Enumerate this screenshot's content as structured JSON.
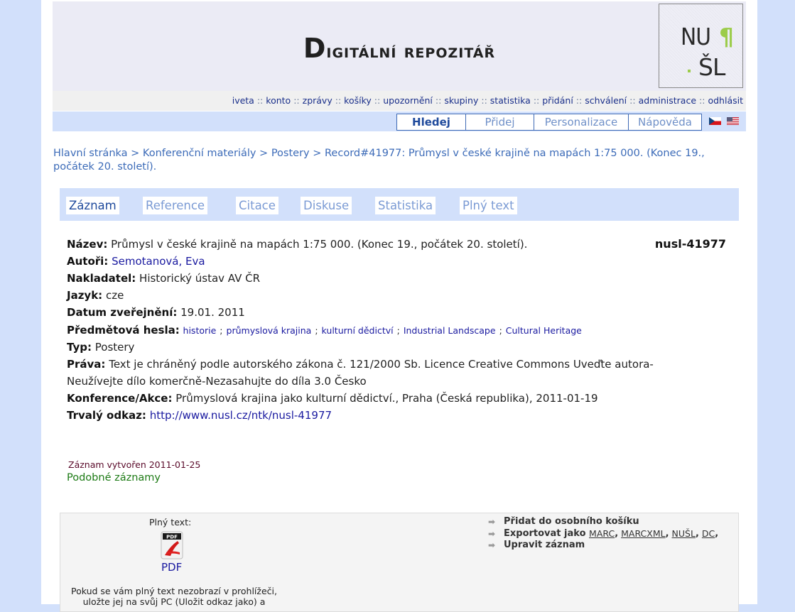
{
  "header": {
    "site_title_first": "D",
    "site_title_rest": "igitální repozitář",
    "logo": {
      "line1": "NU",
      "pilcrow": "¶",
      "line2": "ŠL"
    }
  },
  "userbar": {
    "links": [
      "iveta",
      "konto",
      "zprávy",
      "košíky",
      "upozornění",
      "skupiny",
      "statistika",
      "přidání",
      "schválení",
      "administrace",
      "odhlásit"
    ],
    "separator": "::"
  },
  "nav": {
    "tabs": [
      {
        "label": "Hledej",
        "active": true
      },
      {
        "label": "Přidej",
        "active": false
      },
      {
        "label": "Personalizace",
        "active": false
      },
      {
        "label": "Nápověda",
        "active": false
      }
    ],
    "flags": [
      "czech-flag-icon",
      "us-flag-icon"
    ]
  },
  "breadcrumb": {
    "items": [
      "Hlavní stránka",
      "Konferenční materiály",
      "Postery"
    ],
    "separator": ">",
    "current": "Record#41977: Průmysl v české krajině na mapách 1:75 000. (Konec 19., počátek 20. století)."
  },
  "record_tabs": [
    {
      "label": "Záznam",
      "active": true
    },
    {
      "label": "Reference",
      "active": false
    },
    {
      "label": "Citace",
      "active": false
    },
    {
      "label": "Diskuse",
      "active": false
    },
    {
      "label": "Statistika",
      "active": false
    },
    {
      "label": "Plný text",
      "active": false
    }
  ],
  "record": {
    "id": "nusl-41977",
    "title_label": "Název:",
    "title": "Průmysl v české krajině na mapách 1:75 000. (Konec 19., počátek 20. století).",
    "authors_label": "Autoři:",
    "authors": "Semotanová, Eva",
    "publisher_label": "Nakladatel:",
    "publisher": "Historický ústav AV ČR",
    "language_label": "Jazyk:",
    "language": "cze",
    "date_label": "Datum zveřejnění:",
    "date": "19.01. 2011",
    "keywords_label": "Předmětová hesla:",
    "keywords": [
      "historie",
      "průmyslová krajina",
      "kulturní dědictví",
      "Industrial Landscape",
      "Cultural Heritage"
    ],
    "keyword_separator": ";",
    "type_label": "Typ:",
    "type": "Postery",
    "rights_label": "Práva:",
    "rights_line1": "Text je chráněný podle autorského zákona č. 121/2000 Sb. Licence Creative Commons Uveďte autora-",
    "rights_line2": "Neužívejte dílo komerčně-Nezasahujte do díla 3.0 Česko",
    "conference_label": "Konference/Akce:",
    "conference": "Průmyslová krajina jako kulturní dědictví., Praha (Česká republika), 2011-01-19",
    "permalink_label": "Trvalý odkaz:",
    "permalink": "http://www.nusl.cz/ntk/nusl-41977"
  },
  "created": "Záznam vytvořen 2011-01-25",
  "similar": "Podobné záznamy",
  "fulltext": {
    "label": "Plný text:",
    "pdf_label": "PDF",
    "note_line1": "Pokud se vám plný text nezobrazí v prohlížeči,",
    "note_line2": "uložte jej na svůj PC (Uložit odkaz jako) a"
  },
  "actions": {
    "add_basket": "Přidat do osobního košíku",
    "export_label": "Exportovat jako",
    "export_formats": [
      "MARC",
      "MARCXML",
      "NUŠL",
      "DC"
    ],
    "edit": "Upravit záznam"
  }
}
